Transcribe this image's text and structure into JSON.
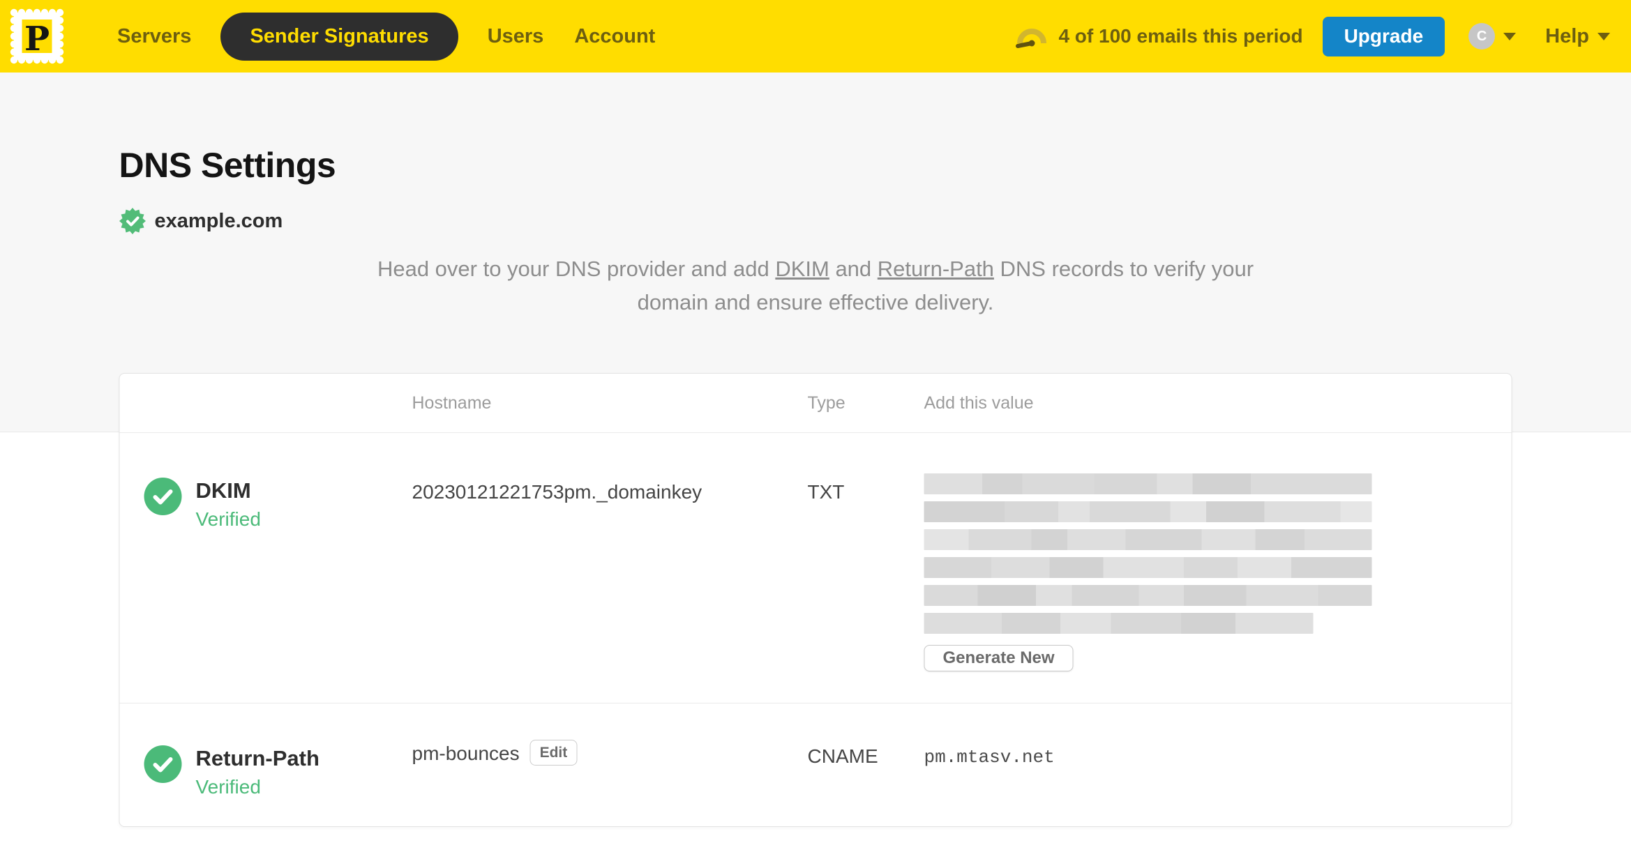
{
  "navbar": {
    "logo_letter": "P",
    "nav_items": [
      {
        "label": "Servers",
        "active": false
      },
      {
        "label": "Sender Signatures",
        "active": true
      },
      {
        "label": "Users",
        "active": false
      },
      {
        "label": "Account",
        "active": false
      }
    ],
    "usage_text": "4 of 100 emails this period",
    "upgrade_label": "Upgrade",
    "avatar_initial": "C",
    "help_label": "Help"
  },
  "page": {
    "title": "DNS Settings",
    "domain": "example.com",
    "intro": {
      "part1": "Head over to your DNS provider and add ",
      "link_dkim": "DKIM",
      "part2": " and ",
      "link_return_path": "Return-Path",
      "part3": " DNS records to verify your domain and ensure effective delivery."
    }
  },
  "dns_table": {
    "headers": {
      "hostname": "Hostname",
      "type": "Type",
      "value": "Add this value"
    },
    "rows": [
      {
        "name": "DKIM",
        "status": "Verified",
        "hostname": "20230121221753pm._domainkey",
        "type": "TXT",
        "value_redacted": true,
        "action_label": "Generate New"
      },
      {
        "name": "Return-Path",
        "status": "Verified",
        "hostname": "pm-bounces",
        "edit_label": "Edit",
        "type": "CNAME",
        "value": "pm.mtasv.net"
      }
    ]
  },
  "colors": {
    "brand_yellow": "#ffdd00",
    "nav_active_bg": "#2e2e2e",
    "upgrade_blue": "#1485c8",
    "verified_green": "#4bba79",
    "hero_bg": "#f7f7f7"
  }
}
